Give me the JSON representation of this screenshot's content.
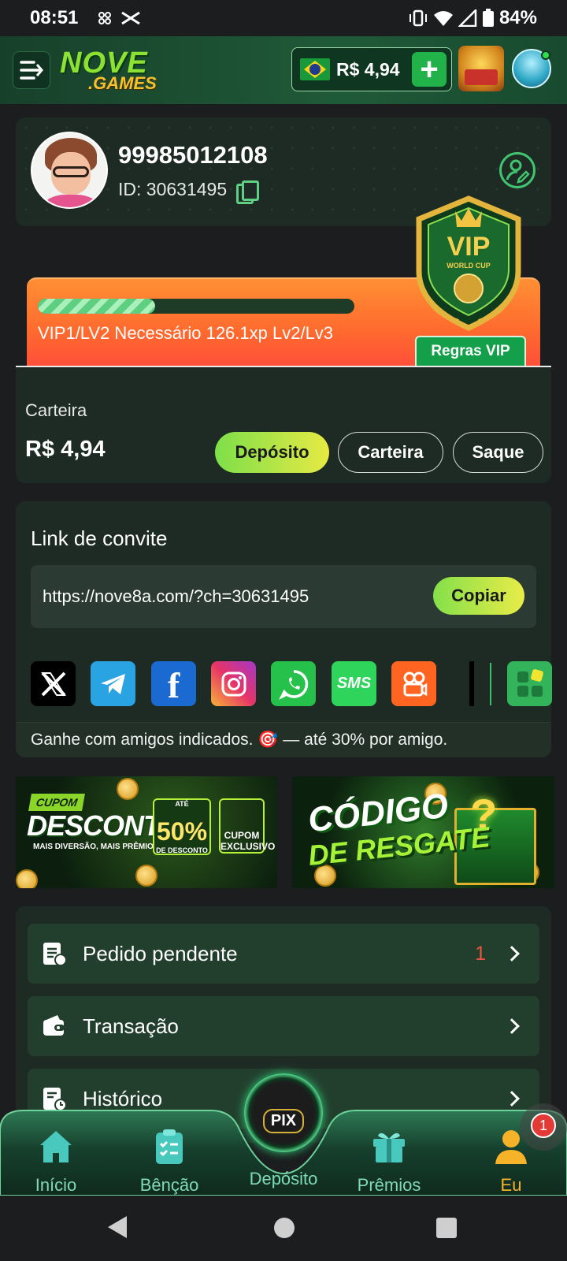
{
  "status_bar": {
    "time": "08:51",
    "battery": "84%"
  },
  "header": {
    "logo_line1": "NOVE",
    "logo_line2": ".GAMES",
    "balance": "R$ 4,94",
    "plus_label": "+"
  },
  "profile": {
    "name": "99985012108",
    "id_text": "ID: 30631495"
  },
  "vip": {
    "badge_title": "VIP",
    "badge_subtitle": "WORLD CUP",
    "progress_fraction": 0.37,
    "level_text": "VIP1/LV2  Necessário 126.1xp Lv2/Lv3",
    "rules_button": "Regras VIP"
  },
  "wallet": {
    "label": "Carteira",
    "amount": "R$ 4,94",
    "deposit_button": "Depósito",
    "wallet_button": "Carteira",
    "withdraw_button": "Saque"
  },
  "invite": {
    "title": "Link de convite",
    "url": "https://nove8a.com/?ch=30631495",
    "copy_button": "Copiar",
    "share_icons": [
      "x-icon",
      "telegram-icon",
      "facebook-icon",
      "instagram-icon",
      "whatsapp-icon",
      "sms-icon",
      "kwai-icon",
      "more-apps-icon"
    ],
    "sms_label": "SMS",
    "footer_text": "Ganhe com amigos indicados. 🎯 — até 30% por amigo."
  },
  "banners": {
    "cupom": {
      "tag": "CUPOM",
      "title": "DESCONTO",
      "subtitle": "MAIS DIVERSÃO, MAIS PRÊMIOS!",
      "percent": "50%",
      "percent_top": "ATÉ",
      "percent_sub": "DE DESCONTO",
      "exclusive": "CUPOM EXCLUSIVO"
    },
    "codigo": {
      "line1": "CÓDIGO",
      "line2": "DE RESGATE",
      "symbol": "?"
    }
  },
  "menu": {
    "items": [
      {
        "label": "Pedido pendente",
        "count": "1"
      },
      {
        "label": "Transação"
      },
      {
        "label": "Histórico"
      }
    ]
  },
  "bottom_nav": {
    "items": [
      {
        "label": "Início"
      },
      {
        "label": "Bênção"
      },
      {
        "label": "Depósito"
      },
      {
        "label": "Prêmios"
      },
      {
        "label": "Eu"
      }
    ],
    "pix_label": "PIX",
    "notification_count": "1"
  },
  "colors": {
    "accent_green": "#21b34a",
    "active_tab": "#f6b32a",
    "inactive_tab": "#7fd9b8",
    "card_bg": "#1e2b25",
    "vip_orange": "#ff6a2e"
  }
}
